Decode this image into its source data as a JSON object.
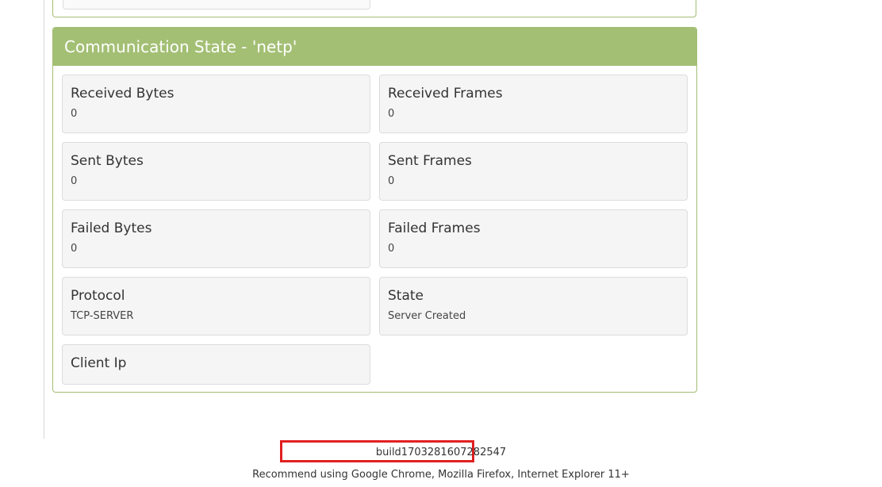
{
  "panel": {
    "title": "Communication State - 'netp'",
    "header_color": "#a3bf74",
    "fields": [
      {
        "label": "Received Bytes",
        "value": "0"
      },
      {
        "label": "Received Frames",
        "value": "0"
      },
      {
        "label": "Sent Bytes",
        "value": "0"
      },
      {
        "label": "Sent Frames",
        "value": "0"
      },
      {
        "label": "Failed Bytes",
        "value": "0"
      },
      {
        "label": "Failed Frames",
        "value": "0"
      },
      {
        "label": "Protocol",
        "value": "TCP-SERVER"
      },
      {
        "label": "State",
        "value": "Server Created"
      },
      {
        "label": "Client Ip",
        "value": ""
      }
    ]
  },
  "footer": {
    "build": "build1703281607282547",
    "recommendation": "Recommend using Google Chrome, Mozilla Firefox, Internet Explorer 11+",
    "highlight_color": "#e02020"
  }
}
